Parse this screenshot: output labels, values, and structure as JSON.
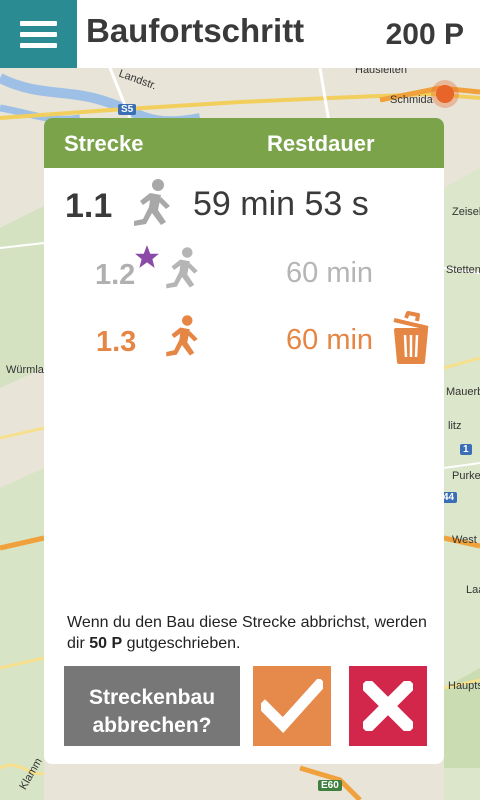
{
  "header": {
    "title": "Baufortschritt",
    "points": "200 P"
  },
  "map": {
    "labels": [
      "Hausleiten",
      "Landstr.",
      "Schmida",
      "Zeisel",
      "Stetten",
      "Würmla",
      "Mauerba",
      "litz",
      "Purke",
      "West",
      "Laa",
      "Hauptst",
      "Klamm"
    ],
    "shields": [
      "S5",
      "1",
      "44",
      "E60"
    ]
  },
  "dialog": {
    "col_route": "Strecke",
    "col_remaining": "Restdauer",
    "rows": [
      {
        "id": "1.1",
        "time": "59 min 53 s",
        "state": "active",
        "icon": "runner-icon"
      },
      {
        "id": "1.2",
        "time": "60 min",
        "state": "queued",
        "icon": "runner-icon",
        "badge": "star-icon"
      },
      {
        "id": "1.3",
        "time": "60 min",
        "state": "selected",
        "icon": "runner-icon",
        "action": "trash-icon"
      }
    ],
    "message_pre": "Wenn du den Bau diese Strecke abbrichst, werden dir ",
    "message_bold": "50 P",
    "message_post": " gutgeschrieben.",
    "abort_line1": "Streckenbau",
    "abort_line2": "abbrechen?",
    "confirm_icon": "checkmark-icon",
    "cancel_icon": "close-icon"
  },
  "colors": {
    "accent_teal": "#2b8b92",
    "header_green": "#7ba34a",
    "orange": "#e58644",
    "red": "#d2274b",
    "gray_button": "#777777"
  }
}
